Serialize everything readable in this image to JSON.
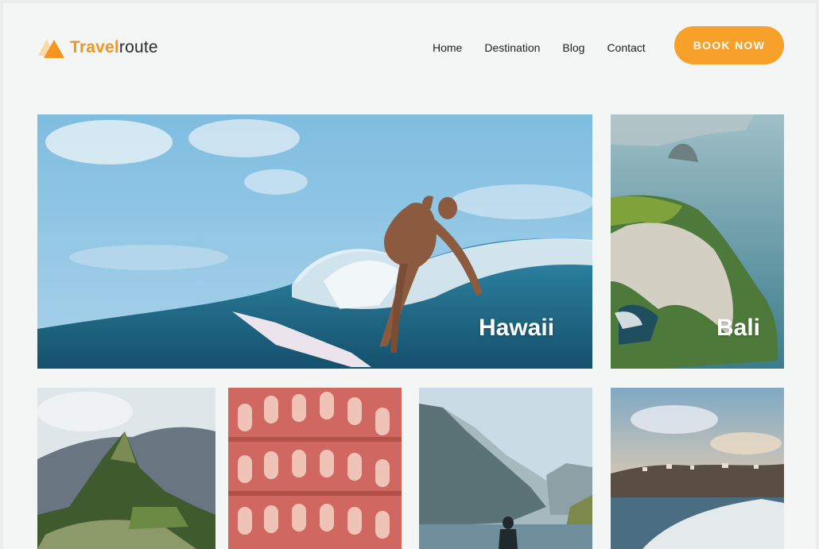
{
  "brand": {
    "name_bold": "Travel",
    "name_light": "route",
    "accent_color": "#f7941d"
  },
  "nav": {
    "items": [
      {
        "label": "Home"
      },
      {
        "label": "Destination"
      },
      {
        "label": "Blog"
      },
      {
        "label": "Contact"
      }
    ]
  },
  "cta": {
    "label": "BOOK NOW",
    "color": "#f7a12b"
  },
  "destinations": {
    "featured": [
      {
        "label": "Hawaii",
        "image": "surfer riding a wave"
      },
      {
        "label": "Bali",
        "image": "green sea cliff above the ocean"
      }
    ],
    "grid": [
      {
        "image": "Machu Picchu mountains"
      },
      {
        "image": "pink ornate palace facade"
      },
      {
        "image": "fjord with a person silhouette"
      },
      {
        "image": "coastal town seen from a boat wake"
      }
    ]
  }
}
